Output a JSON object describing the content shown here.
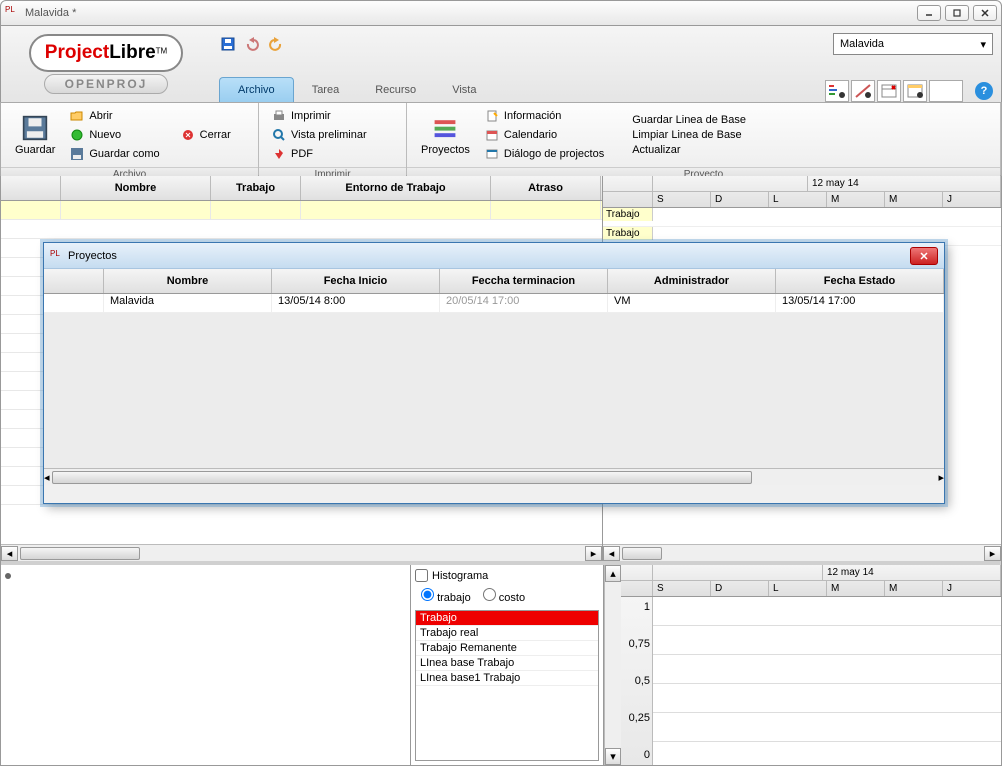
{
  "window": {
    "title": "Malavida *"
  },
  "logo": {
    "part1": "Project",
    "part2": "Libre",
    "tm": "TM",
    "sub": "OPENPROJ"
  },
  "projectSelect": {
    "value": "Malavida"
  },
  "tabs": {
    "archivo": "Archivo",
    "tarea": "Tarea",
    "recurso": "Recurso",
    "vista": "Vista"
  },
  "ribbon": {
    "archivo": {
      "label": "Archivo",
      "guardar": "Guardar",
      "abrir": "Abrir",
      "nuevo": "Nuevo",
      "guardarComo": "Guardar como",
      "cerrar": "Cerrar"
    },
    "imprimir": {
      "label": "Imprimir",
      "imprimir": "Imprimir",
      "vistaPreliminar": "Vista preliminar",
      "pdf": "PDF"
    },
    "proyecto": {
      "label": "Proyecto",
      "proyectos": "Proyectos",
      "informacion": "Información",
      "calendario": "Calendario",
      "dialogo": "Diálogo de projectos",
      "guardarLinea": "Guardar Linea de Base",
      "limpiarLinea": "Limpiar Linea de Base",
      "actualizar": "Actualizar"
    }
  },
  "grid": {
    "headers": {
      "blank": "",
      "nombre": "Nombre",
      "trabajo": "Trabajo",
      "entorno": "Entorno de Trabajo",
      "atraso": "Atraso"
    }
  },
  "gantt": {
    "date": "12 may 14",
    "days": [
      "S",
      "D",
      "L",
      "M",
      "M",
      "J"
    ],
    "rowLabel": "Trabajo"
  },
  "dialog": {
    "title": "Proyectos",
    "headers": {
      "nombre": "Nombre",
      "inicio": "Fecha Inicio",
      "fin": "Feccha terminacion",
      "admin": "Administrador",
      "estado": "Fecha Estado"
    },
    "row": {
      "nombre": "Malavida",
      "inicio": "13/05/14 8:00",
      "fin": "20/05/14 17:00",
      "admin": "VM",
      "estado": "13/05/14 17:00"
    }
  },
  "bottom": {
    "histograma": "Histograma",
    "trabajo": "trabajo",
    "costo": "costo",
    "listItems": [
      "Trabajo",
      "Trabajo real",
      "Trabajo Remanente",
      "LInea base Trabajo",
      "LInea base1 Trabajo"
    ]
  },
  "chart": {
    "yticks": [
      "1",
      "0,75",
      "0,5",
      "0,25",
      "0"
    ]
  }
}
